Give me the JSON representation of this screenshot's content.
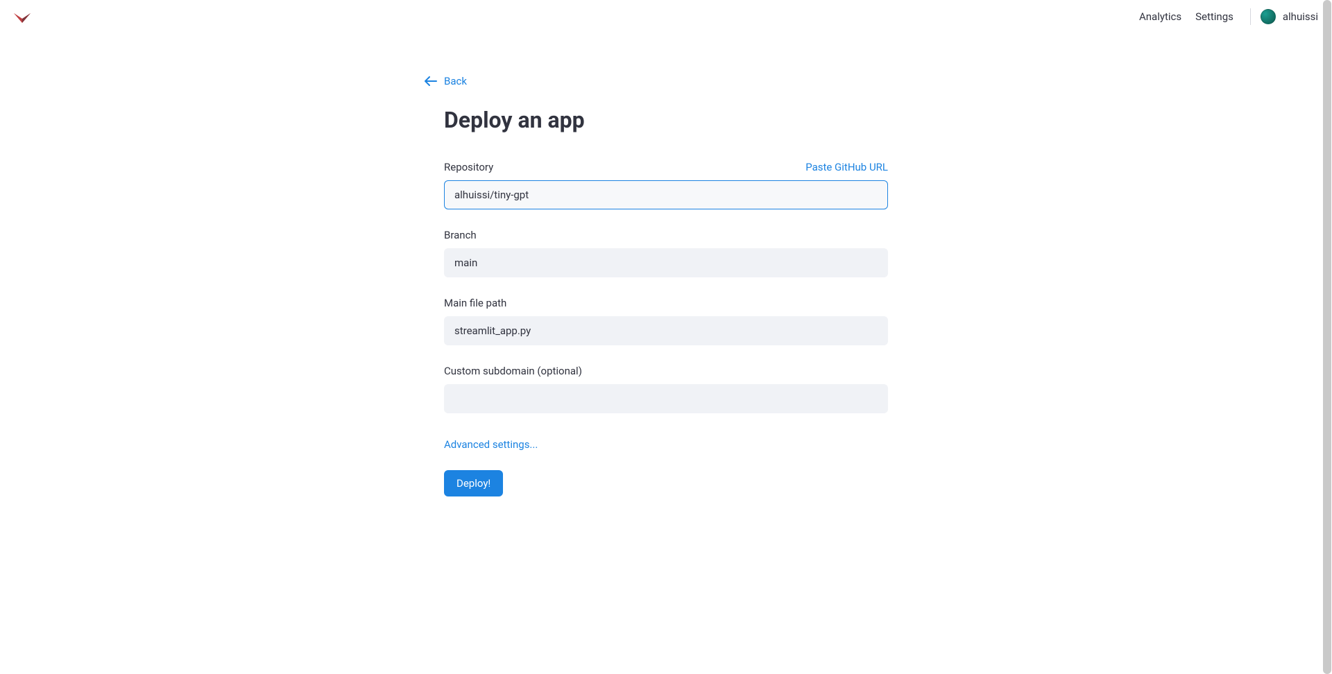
{
  "header": {
    "nav": {
      "analytics": "Analytics",
      "settings": "Settings"
    },
    "username": "alhuissi"
  },
  "page": {
    "back_label": "Back",
    "title": "Deploy an app"
  },
  "form": {
    "repository": {
      "label": "Repository",
      "side_link": "Paste GitHub URL",
      "value": "alhuissi/tiny-gpt"
    },
    "branch": {
      "label": "Branch",
      "value": "main"
    },
    "main_file": {
      "label": "Main file path",
      "value": "streamlit_app.py"
    },
    "subdomain": {
      "label": "Custom subdomain (optional)",
      "value": ""
    },
    "advanced_settings": "Advanced settings...",
    "deploy_button": "Deploy!"
  }
}
